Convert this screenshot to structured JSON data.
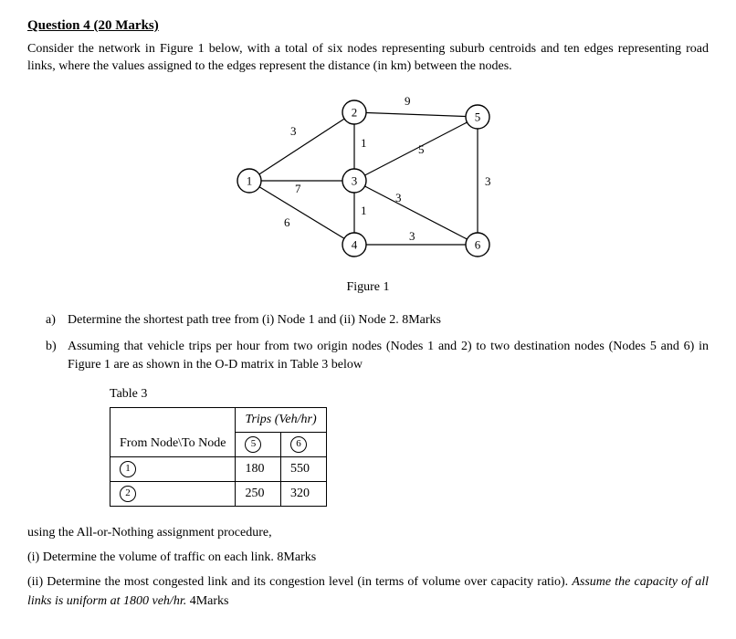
{
  "title": "Question 4   (20 Marks)",
  "intro": "Consider the network in Figure 1 below, with a total of six nodes representing suburb centroids and ten edges representing road links, where the values assigned to the edges represent the distance (in km) between the nodes.",
  "figure": {
    "caption": "Figure 1",
    "nodes": {
      "1": "1",
      "2": "2",
      "3": "3",
      "4": "4",
      "5": "5",
      "6": "6"
    },
    "edge_labels": {
      "e12": "3",
      "e13": "7",
      "e14": "6",
      "e23": "1",
      "e25": "9",
      "e34": "1",
      "e35": "5",
      "e36": "3",
      "e46": "3",
      "e56": "3"
    }
  },
  "parts": {
    "a": {
      "letter": "a)",
      "text": "Determine the shortest path tree from (i) Node 1 and (ii) Node 2.   8Marks"
    },
    "b": {
      "letter": "b)",
      "text": "Assuming that vehicle trips per hour from two origin nodes (Nodes 1 and 2) to two destination nodes (Nodes 5 and 6) in Figure 1 are as shown in the O-D matrix in Table 3 below"
    }
  },
  "table": {
    "label": "Table 3",
    "header": {
      "trips": "Trips (Veh/hr)"
    },
    "rowhead": "From Node\\To Node",
    "col5": "5",
    "col6": "6",
    "r1": "1",
    "r2": "2",
    "v15": "180",
    "v16": "550",
    "v25": "250",
    "v26": "320"
  },
  "tail": {
    "t1": "using the All-or-Nothing assignment procedure,",
    "t2": "(i) Determine the volume of traffic on each link.     8Marks",
    "t3a": "(ii) Determine the most congested link and its congestion level (in terms of volume over capacity ratio).   ",
    "t3b": "Assume the capacity of all links is uniform at 1800 veh/hr.",
    "t3c": "   4Marks"
  },
  "chart_data": {
    "type": "table",
    "description": "Network graph: 6 nodes, 10 weighted edges (distances in km)",
    "nodes": [
      1,
      2,
      3,
      4,
      5,
      6
    ],
    "edges": [
      {
        "from": 1,
        "to": 2,
        "w": 3
      },
      {
        "from": 1,
        "to": 3,
        "w": 7
      },
      {
        "from": 1,
        "to": 4,
        "w": 6
      },
      {
        "from": 2,
        "to": 3,
        "w": 1
      },
      {
        "from": 2,
        "to": 5,
        "w": 9
      },
      {
        "from": 3,
        "to": 4,
        "w": 1
      },
      {
        "from": 3,
        "to": 5,
        "w": 5
      },
      {
        "from": 3,
        "to": 6,
        "w": 3
      },
      {
        "from": 4,
        "to": 6,
        "w": 3
      },
      {
        "from": 5,
        "to": 6,
        "w": 3
      }
    ],
    "od_matrix": {
      "origins": [
        1,
        2
      ],
      "destinations": [
        5,
        6
      ],
      "trips": {
        "1-5": 180,
        "1-6": 550,
        "2-5": 250,
        "2-6": 320
      },
      "units": "veh/hr"
    },
    "link_capacity_veh_per_hr": 1800
  }
}
